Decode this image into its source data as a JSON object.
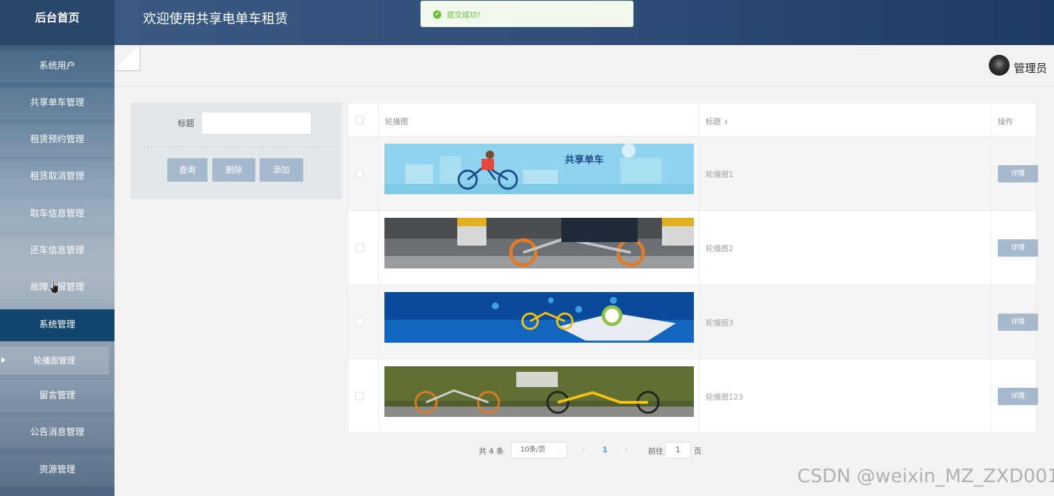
{
  "sidebar": {
    "brand": "后台首页",
    "items": [
      {
        "label": "系统用户"
      },
      {
        "label": "共享单车管理"
      },
      {
        "label": "租赁预约管理"
      },
      {
        "label": "租赁取消管理"
      },
      {
        "label": "取车信息管理"
      },
      {
        "label": "还车信息管理"
      },
      {
        "label": "故障上报管理"
      },
      {
        "label": "系统管理"
      },
      {
        "label": "轮播图管理"
      },
      {
        "label": "留言管理"
      },
      {
        "label": "公告消息管理"
      },
      {
        "label": "资源管理"
      }
    ]
  },
  "header": {
    "title": "欢迎使用共享电单车租赁"
  },
  "toast": {
    "message": "提交成功!"
  },
  "user": {
    "name": "管理员"
  },
  "search": {
    "title_label": "标题",
    "title_value": "",
    "query_label": "查询",
    "delete_label": "删除",
    "add_label": "添加"
  },
  "table": {
    "columns": [
      "轮播图",
      "标题",
      "操作"
    ],
    "rows": [
      {
        "title": "轮播图1",
        "action": "详情",
        "image": "banner-shared-bike-cartoon"
      },
      {
        "title": "轮播图2",
        "action": "详情",
        "image": "photo-rider-orange-bike"
      },
      {
        "title": "轮播图3",
        "action": "详情",
        "image": "graphic-bike-map-blue"
      },
      {
        "title": "轮播图123",
        "action": "详情",
        "image": "photo-bikes-hedge"
      }
    ],
    "banner_text": "共享单车"
  },
  "pagination": {
    "total": "共 4 条",
    "page_size": "10条/页",
    "current_page": "1",
    "goto_label": "前往",
    "goto_value": "1",
    "goto_unit": "页"
  },
  "watermark": "CSDN @weixin_MZ_ZXD001",
  "colors": {
    "accent": "#409eff",
    "button": "#a7b9cc",
    "success": "#67c23a",
    "sidebar_active": "#12456e"
  }
}
